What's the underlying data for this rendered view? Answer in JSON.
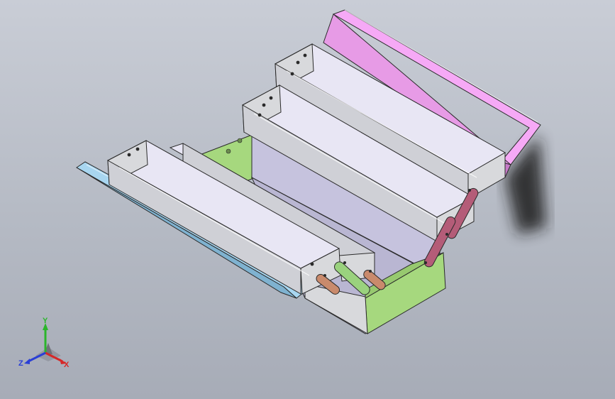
{
  "viewport": {
    "name": "cad-graphics-area",
    "model": "cantilever-toolbox-assembly"
  },
  "colors": {
    "background_top": "#c9cdd6",
    "background_bottom": "#a7acb7",
    "tray_body": "#d8d9dc",
    "tray_floor": "#e8e6f4",
    "lid_pink": "#f6a9f6",
    "lid_blue": "#a8d6f0",
    "box_green": "#a6d87e",
    "box_body": "#b9b6d2",
    "arm_brown": "#c98a6c",
    "arm_green": "#9ad27e",
    "arm_maroon": "#b45c78",
    "outline": "#2a2a2a"
  },
  "triad": {
    "x_label": "X",
    "y_label": "Y",
    "z_label": "Z",
    "x_color": "#d62828",
    "y_color": "#2bb52b",
    "z_color": "#2a3fd6"
  }
}
